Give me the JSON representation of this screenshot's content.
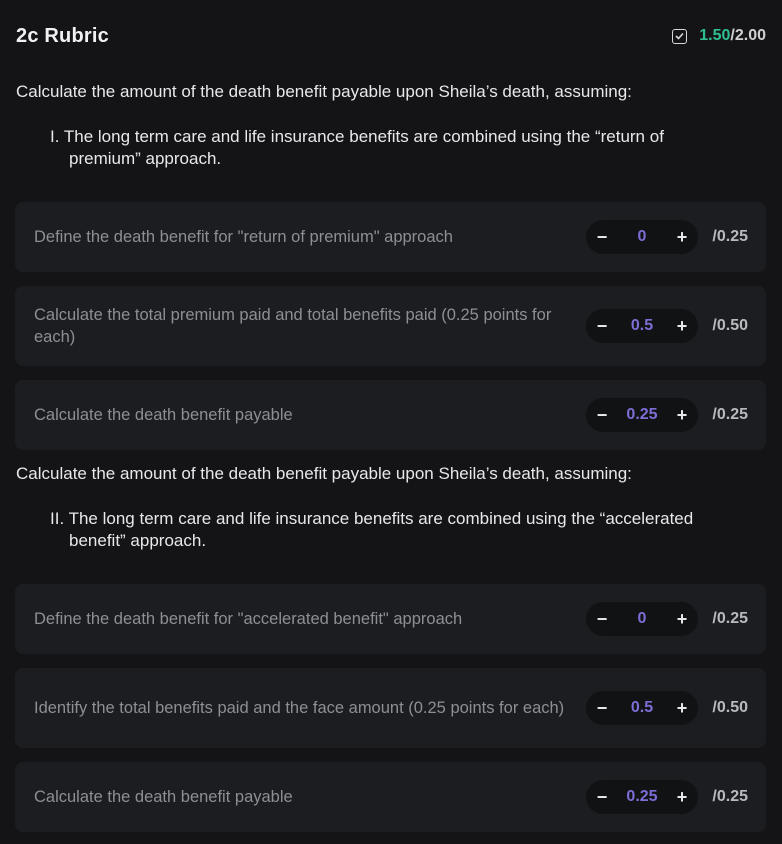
{
  "header": {
    "title": "2c Rubric",
    "score_earned": "1.50",
    "score_sep": "/",
    "score_total": "2.00",
    "check_icon": "checkbox-checked-icon"
  },
  "sections": [
    {
      "question": "Calculate the amount of the death benefit payable upon Sheila’s death, assuming:",
      "item": "I. The long term care and life insurance benefits are combined using the “return of premium” approach.",
      "criteria": [
        {
          "text": "Define the death benefit for \"return of premium\" approach",
          "value": "0",
          "max": "/0.25"
        },
        {
          "text": "Calculate the total premium paid and total benefits paid (0.25 points for each)",
          "value": "0.5",
          "max": "/0.50"
        },
        {
          "text": "Calculate the death benefit payable",
          "value": "0.25",
          "max": "/0.25"
        }
      ]
    },
    {
      "question": "Calculate the amount of the death benefit payable upon Sheila’s death, assuming:",
      "item": "II. The long term care and life insurance benefits are combined using the “accelerated benefit” approach.",
      "criteria": [
        {
          "text": "Define the death benefit for \"accelerated benefit\" approach",
          "value": "0",
          "max": "/0.25"
        },
        {
          "text": "Identify the total benefits paid and the face amount (0.25 points for each)",
          "value": "0.5",
          "max": "/0.50"
        },
        {
          "text": "Calculate the death benefit payable",
          "value": "0.25",
          "max": "/0.25"
        }
      ]
    }
  ],
  "controls": {
    "minus": "−",
    "plus": "+"
  },
  "colors": {
    "background": "#141416",
    "card": "#1c1d20",
    "score_green": "#2fbf8f",
    "value_purple": "#7b6ed6"
  }
}
